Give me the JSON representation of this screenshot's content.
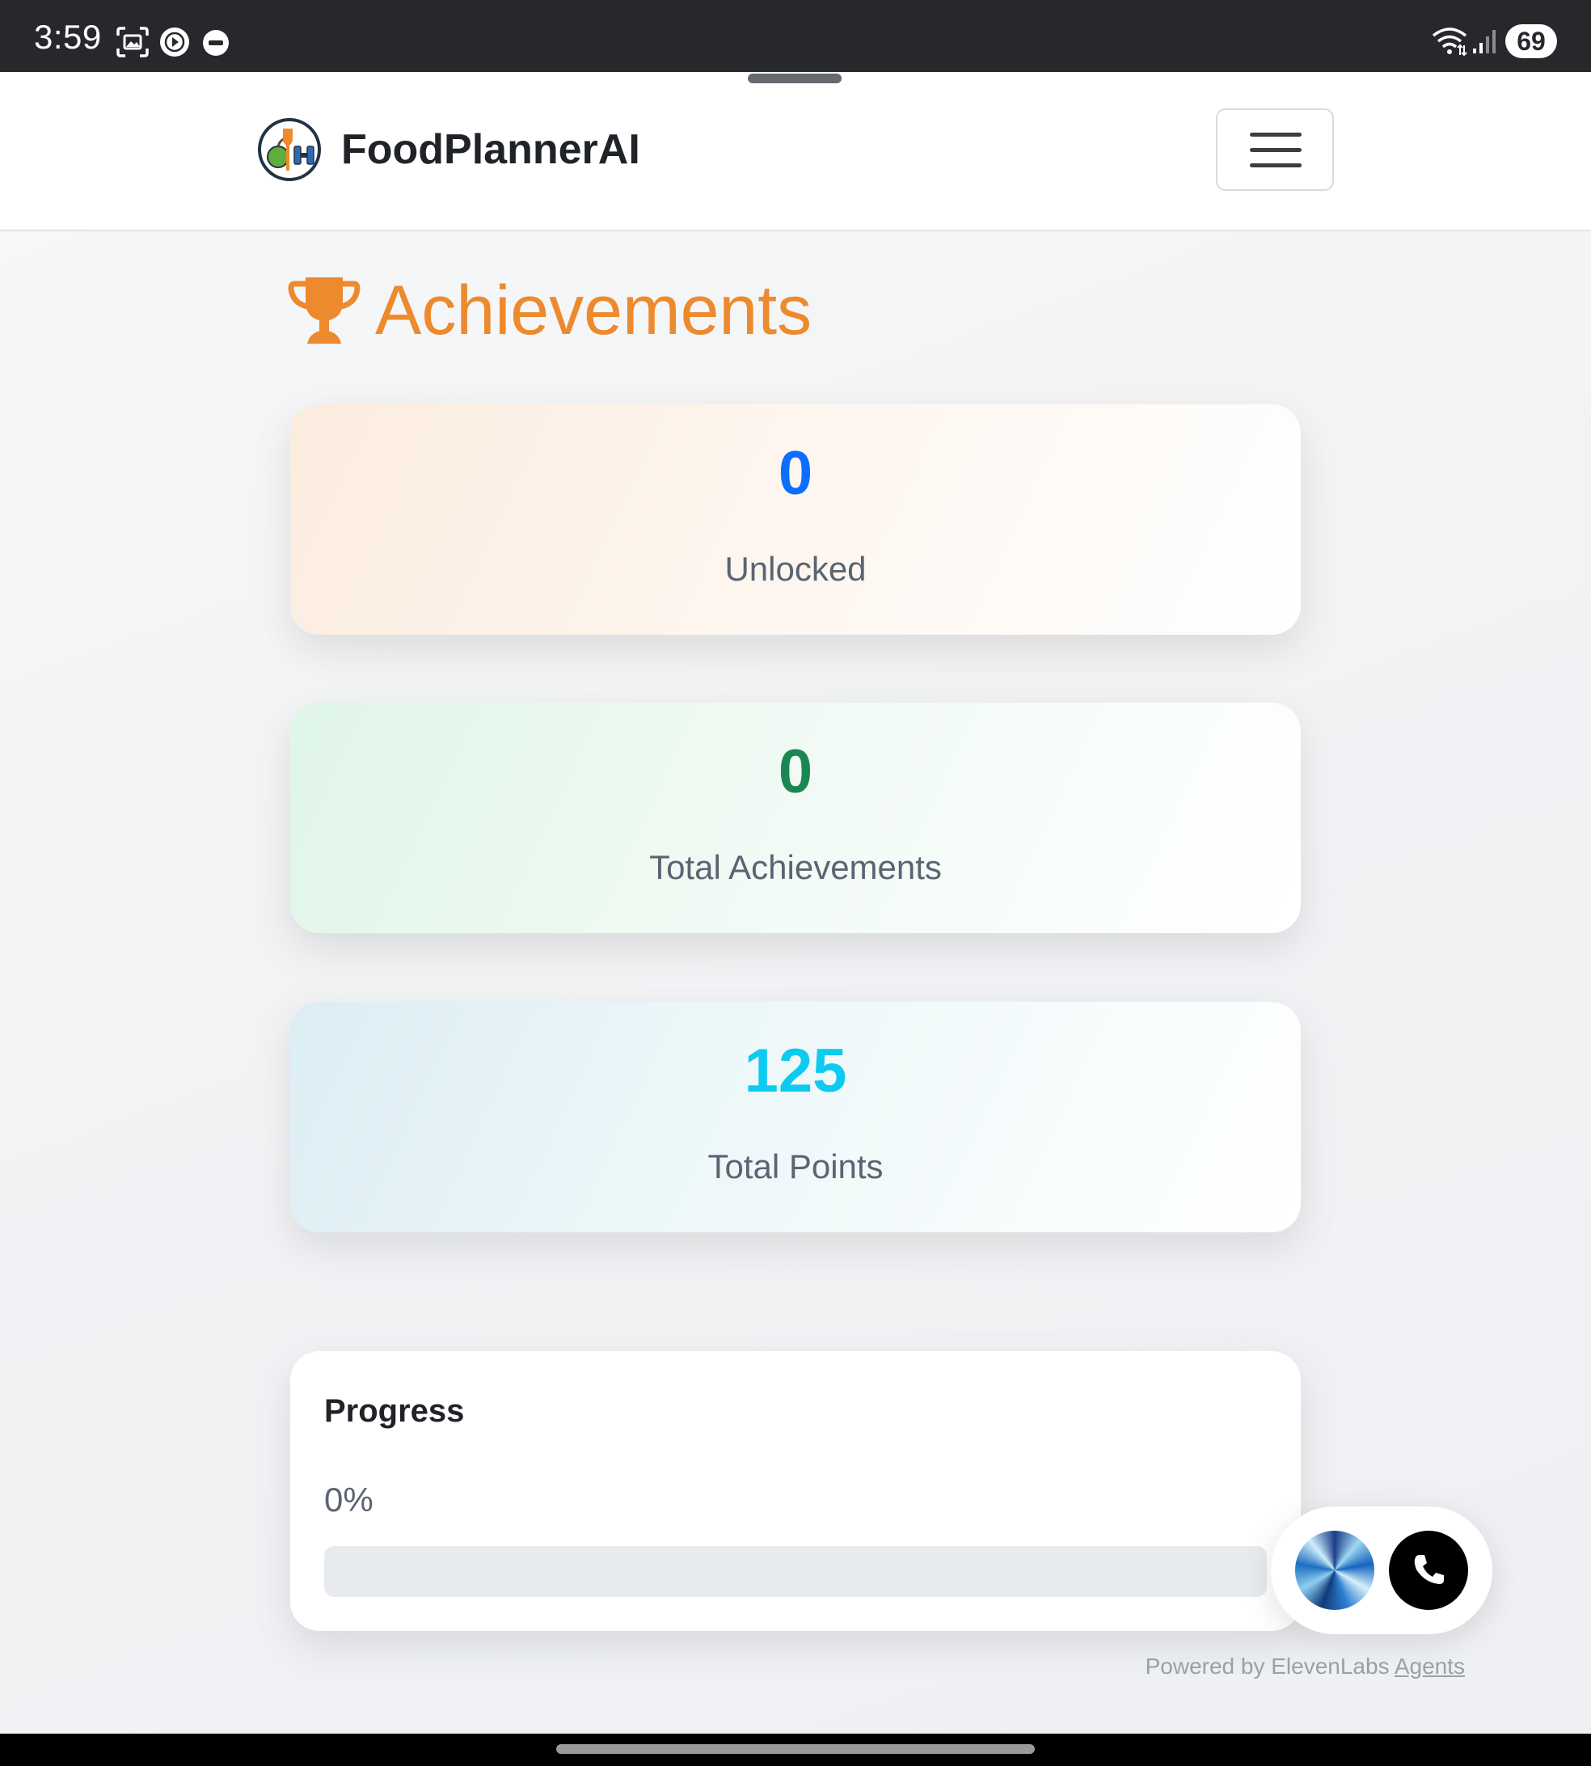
{
  "status_bar": {
    "time": "3:59",
    "icons": [
      "screenshot-icon",
      "play-circle-icon",
      "wear-icon",
      "wifi-icon",
      "signal-icon"
    ],
    "battery": "69"
  },
  "navbar": {
    "brand_name": "FoodPlannerAI",
    "logo_icon": "apple-fork-dumbbell-logo",
    "menu_icon": "hamburger-icon"
  },
  "page": {
    "title": "Achievements",
    "title_icon": "trophy-icon",
    "title_color": "#ed8a2e"
  },
  "stats": [
    {
      "value": "0",
      "label": "Unlocked",
      "color": "#0d6efd"
    },
    {
      "value": "0",
      "label": "Total Achievements",
      "color": "#198754"
    },
    {
      "value": "125",
      "label": "Total Points",
      "color": "#0dcaf0"
    }
  ],
  "progress": {
    "title": "Progress",
    "percent_text": "0%",
    "value": 0
  },
  "voice_widget": {
    "orb_icon": "voice-orb-icon",
    "call_icon": "phone-icon",
    "powered_by_prefix": "Powered by ElevenLabs ",
    "powered_by_link": "Agents"
  }
}
